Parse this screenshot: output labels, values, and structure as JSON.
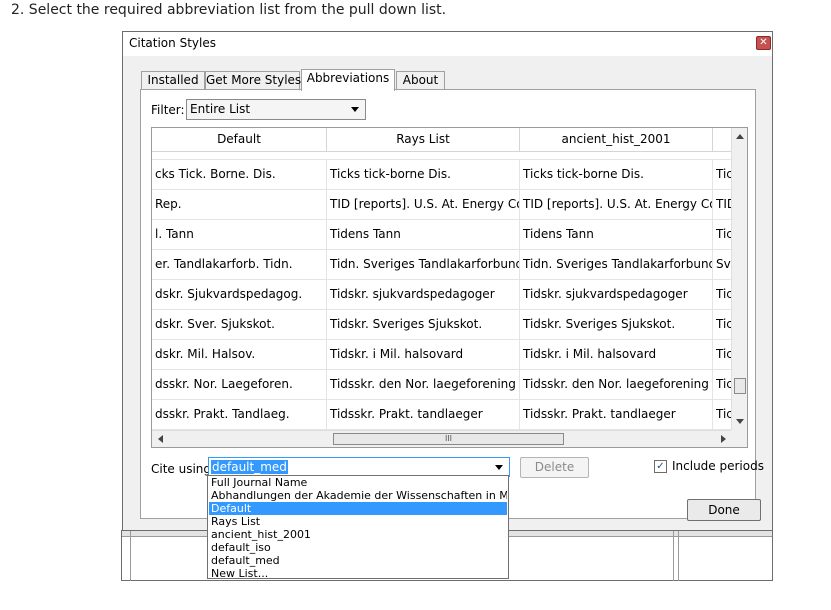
{
  "instruction": "2. Select the required abbreviation list from the pull down list.",
  "dialog": {
    "title": "Citation Styles",
    "close_icon": "close-icon",
    "tabs": [
      {
        "label": "Installed"
      },
      {
        "label": "Get More Styles"
      },
      {
        "label": "Abbreviations"
      },
      {
        "label": "About"
      }
    ],
    "active_tab": "Abbreviations",
    "filter": {
      "label": "Filter:",
      "value": "Entire List"
    },
    "grid": {
      "columns": [
        "Default",
        "Rays List",
        "ancient_hist_2001",
        ""
      ],
      "rows": [
        [
          "cks Tick. Borne. Dis.",
          "Ticks tick-borne Dis.",
          "Ticks tick-borne Dis.",
          "Tic"
        ],
        [
          "Rep.",
          "TID [reports]. U.S. At. Energy Co...",
          "TID [reports]. U.S. At. Energy Co...",
          "TID"
        ],
        [
          "l. Tann",
          "Tidens Tann",
          "Tidens Tann",
          "Tic"
        ],
        [
          "er. Tandlakarforb. Tidn.",
          "Tidn. Sveriges Tandlakarforbund",
          "Tidn. Sveriges Tandlakarforbund",
          "Sv"
        ],
        [
          "dskr. Sjukvardspedagog.",
          "Tidskr. sjukvardspedagoger",
          "Tidskr. sjukvardspedagoger",
          "Tic"
        ],
        [
          "dskr. Sver. Sjukskot.",
          "Tidskr. Sveriges Sjukskot.",
          "Tidskr. Sveriges Sjukskot.",
          "Tic"
        ],
        [
          "dskr. Mil. Halsov.",
          "Tidskr. i Mil. halsovard",
          "Tidskr. i Mil. halsovard",
          "Tic"
        ],
        [
          "dsskr. Nor. Laegeforen.",
          "Tidsskr. den Nor. laegeforening T...",
          "Tidsskr. den Nor. laegeforening T...",
          "Tic"
        ],
        [
          "dsskr. Prakt. Tandlaeg.",
          "Tidsskr. Prakt. tandlaeger",
          "Tidsskr. Prakt. tandlaeger",
          "Tic"
        ]
      ],
      "hscroll_grip": "III"
    },
    "cite_using": {
      "label": "Cite using:",
      "value": "default_med",
      "options": [
        "Full Journal Name",
        "Abhandlungen der Akademie der Wissenschaften in Mainz",
        "Default",
        "Rays List",
        "ancient_hist_2001",
        "default_iso",
        "default_med",
        "New List..."
      ],
      "highlighted": "Default"
    },
    "delete_label": "Delete",
    "include_periods": {
      "label": "Include periods",
      "checked": true
    },
    "done_label": "Done"
  }
}
